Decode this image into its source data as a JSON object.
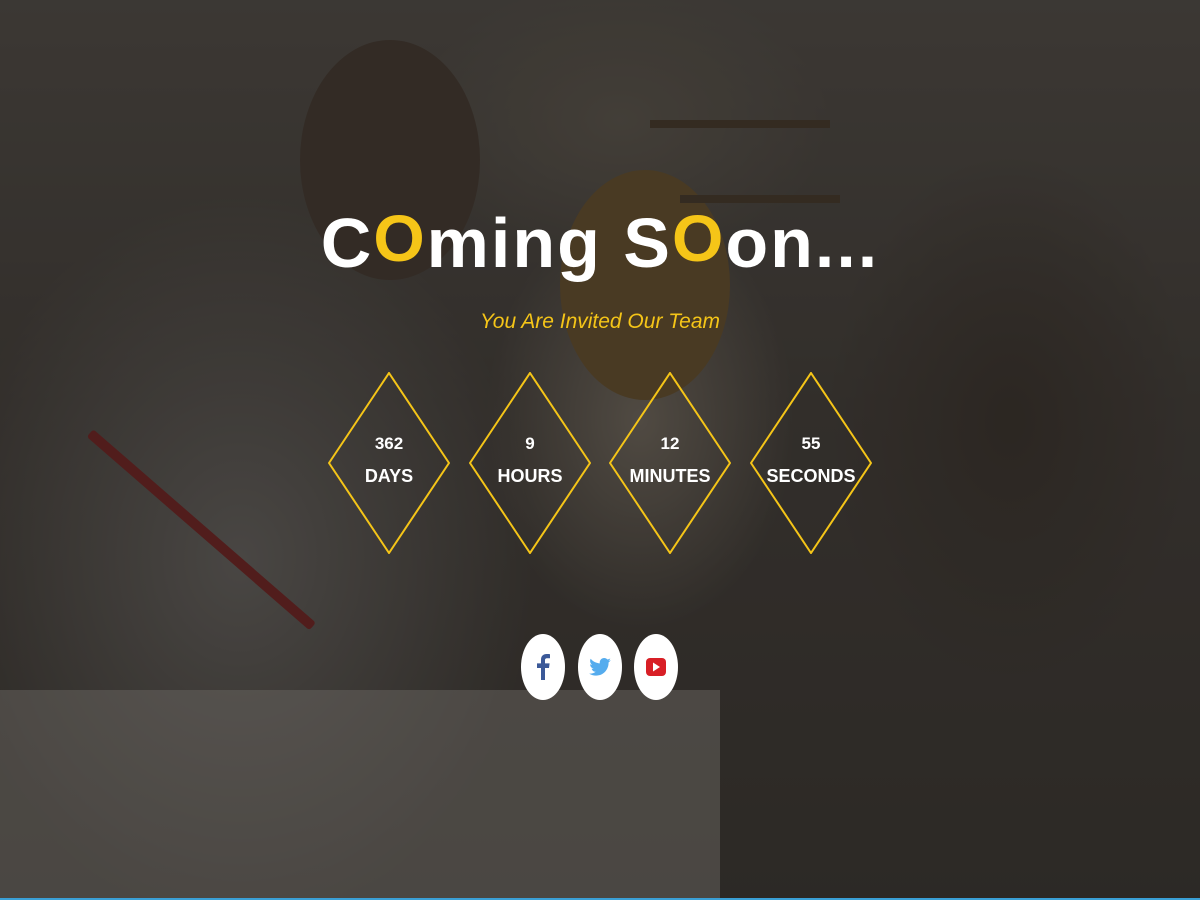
{
  "page": {
    "title_parts": [
      {
        "text": "C",
        "accent": false
      },
      {
        "text": "O",
        "accent": true
      },
      {
        "text": "ming S",
        "accent": false
      },
      {
        "text": "O",
        "accent": true
      },
      {
        "text": "on...",
        "accent": false
      }
    ],
    "subtitle": "You Are Invited Our Team"
  },
  "countdown": [
    {
      "value": "362",
      "label": "DAYS"
    },
    {
      "value": "9",
      "label": "HOURS"
    },
    {
      "value": "12",
      "label": "MINUTES"
    },
    {
      "value": "55",
      "label": "SECONDS"
    }
  ],
  "social": [
    {
      "name": "facebook",
      "icon": "facebook-icon",
      "color": "#3b5998"
    },
    {
      "name": "twitter",
      "icon": "twitter-icon",
      "color": "#55acee"
    },
    {
      "name": "youtube",
      "icon": "youtube-icon",
      "color": "#d81f26"
    }
  ],
  "colors": {
    "accent": "#f5c518",
    "text": "#ffffff",
    "bottom_bar": "#3aa0d6"
  }
}
